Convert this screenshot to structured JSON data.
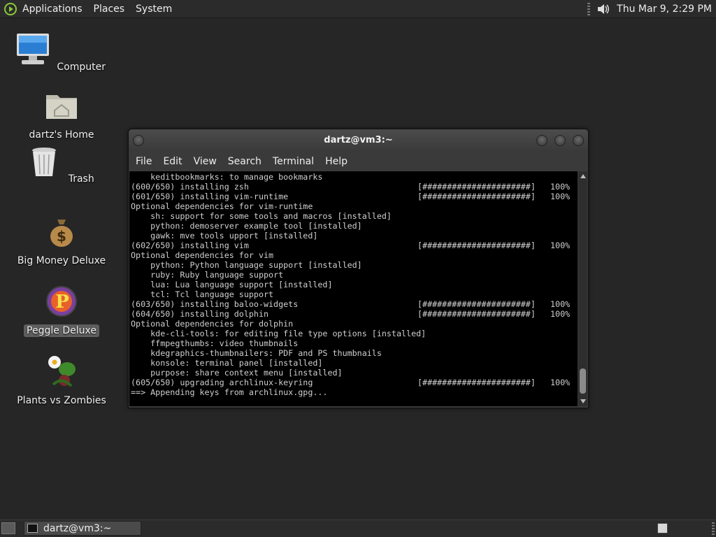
{
  "top_panel": {
    "menus": [
      "Applications",
      "Places",
      "System"
    ],
    "clock": "Thu Mar  9,  2:29 PM"
  },
  "desktop_icons": [
    {
      "label": "Computer",
      "icon": "computer-icon"
    },
    {
      "label": "dartz's Home",
      "icon": "home-folder-icon"
    },
    {
      "label": "Trash",
      "icon": "trash-icon"
    },
    {
      "label": "Big Money Deluxe",
      "icon": "money-bag-icon"
    },
    {
      "label": "Peggle Deluxe",
      "icon": "peggle-icon",
      "selected": true
    },
    {
      "label": "Plants vs Zombies",
      "icon": "plants-vs-zombies-icon"
    }
  ],
  "terminal": {
    "title": "dartz@vm3:~",
    "menus": [
      "File",
      "Edit",
      "View",
      "Search",
      "Terminal",
      "Help"
    ],
    "lines": [
      {
        "text": "    keditbookmarks: to manage bookmarks"
      },
      {
        "text": "(600/650) installing zsh",
        "bar": "[######################]",
        "pct": "100%"
      },
      {
        "text": "(601/650) installing vim-runtime",
        "bar": "[######################]",
        "pct": "100%"
      },
      {
        "text": "Optional dependencies for vim-runtime"
      },
      {
        "text": "    sh: support for some tools and macros [installed]"
      },
      {
        "text": "    python: demoserver example tool [installed]"
      },
      {
        "text": "    gawk: mve tools upport [installed]"
      },
      {
        "text": "(602/650) installing vim",
        "bar": "[######################]",
        "pct": "100%"
      },
      {
        "text": "Optional dependencies for vim"
      },
      {
        "text": "    python: Python language support [installed]"
      },
      {
        "text": "    ruby: Ruby language support"
      },
      {
        "text": "    lua: Lua language support [installed]"
      },
      {
        "text": "    tcl: Tcl language support"
      },
      {
        "text": "(603/650) installing baloo-widgets",
        "bar": "[######################]",
        "pct": "100%"
      },
      {
        "text": "(604/650) installing dolphin",
        "bar": "[######################]",
        "pct": "100%"
      },
      {
        "text": "Optional dependencies for dolphin"
      },
      {
        "text": "    kde-cli-tools: for editing file type options [installed]"
      },
      {
        "text": "    ffmpegthumbs: video thumbnails"
      },
      {
        "text": "    kdegraphics-thumbnailers: PDF and PS thumbnails"
      },
      {
        "text": "    konsole: terminal panel [installed]"
      },
      {
        "text": "    purpose: share context menu [installed]"
      },
      {
        "text": "(605/650) upgrading archlinux-keyring",
        "bar": "[######################]",
        "pct": "100%"
      },
      {
        "text": "==> Appending keys from archlinux.gpg..."
      }
    ]
  },
  "bottom_panel": {
    "task_label": "dartz@vm3:~"
  },
  "colors": {
    "desktop": "#262626",
    "panel": "#2b2b2b",
    "terminal_bg": "#000000",
    "terminal_text": "#cfcfcf",
    "logo_accent": "#8cc83c"
  }
}
